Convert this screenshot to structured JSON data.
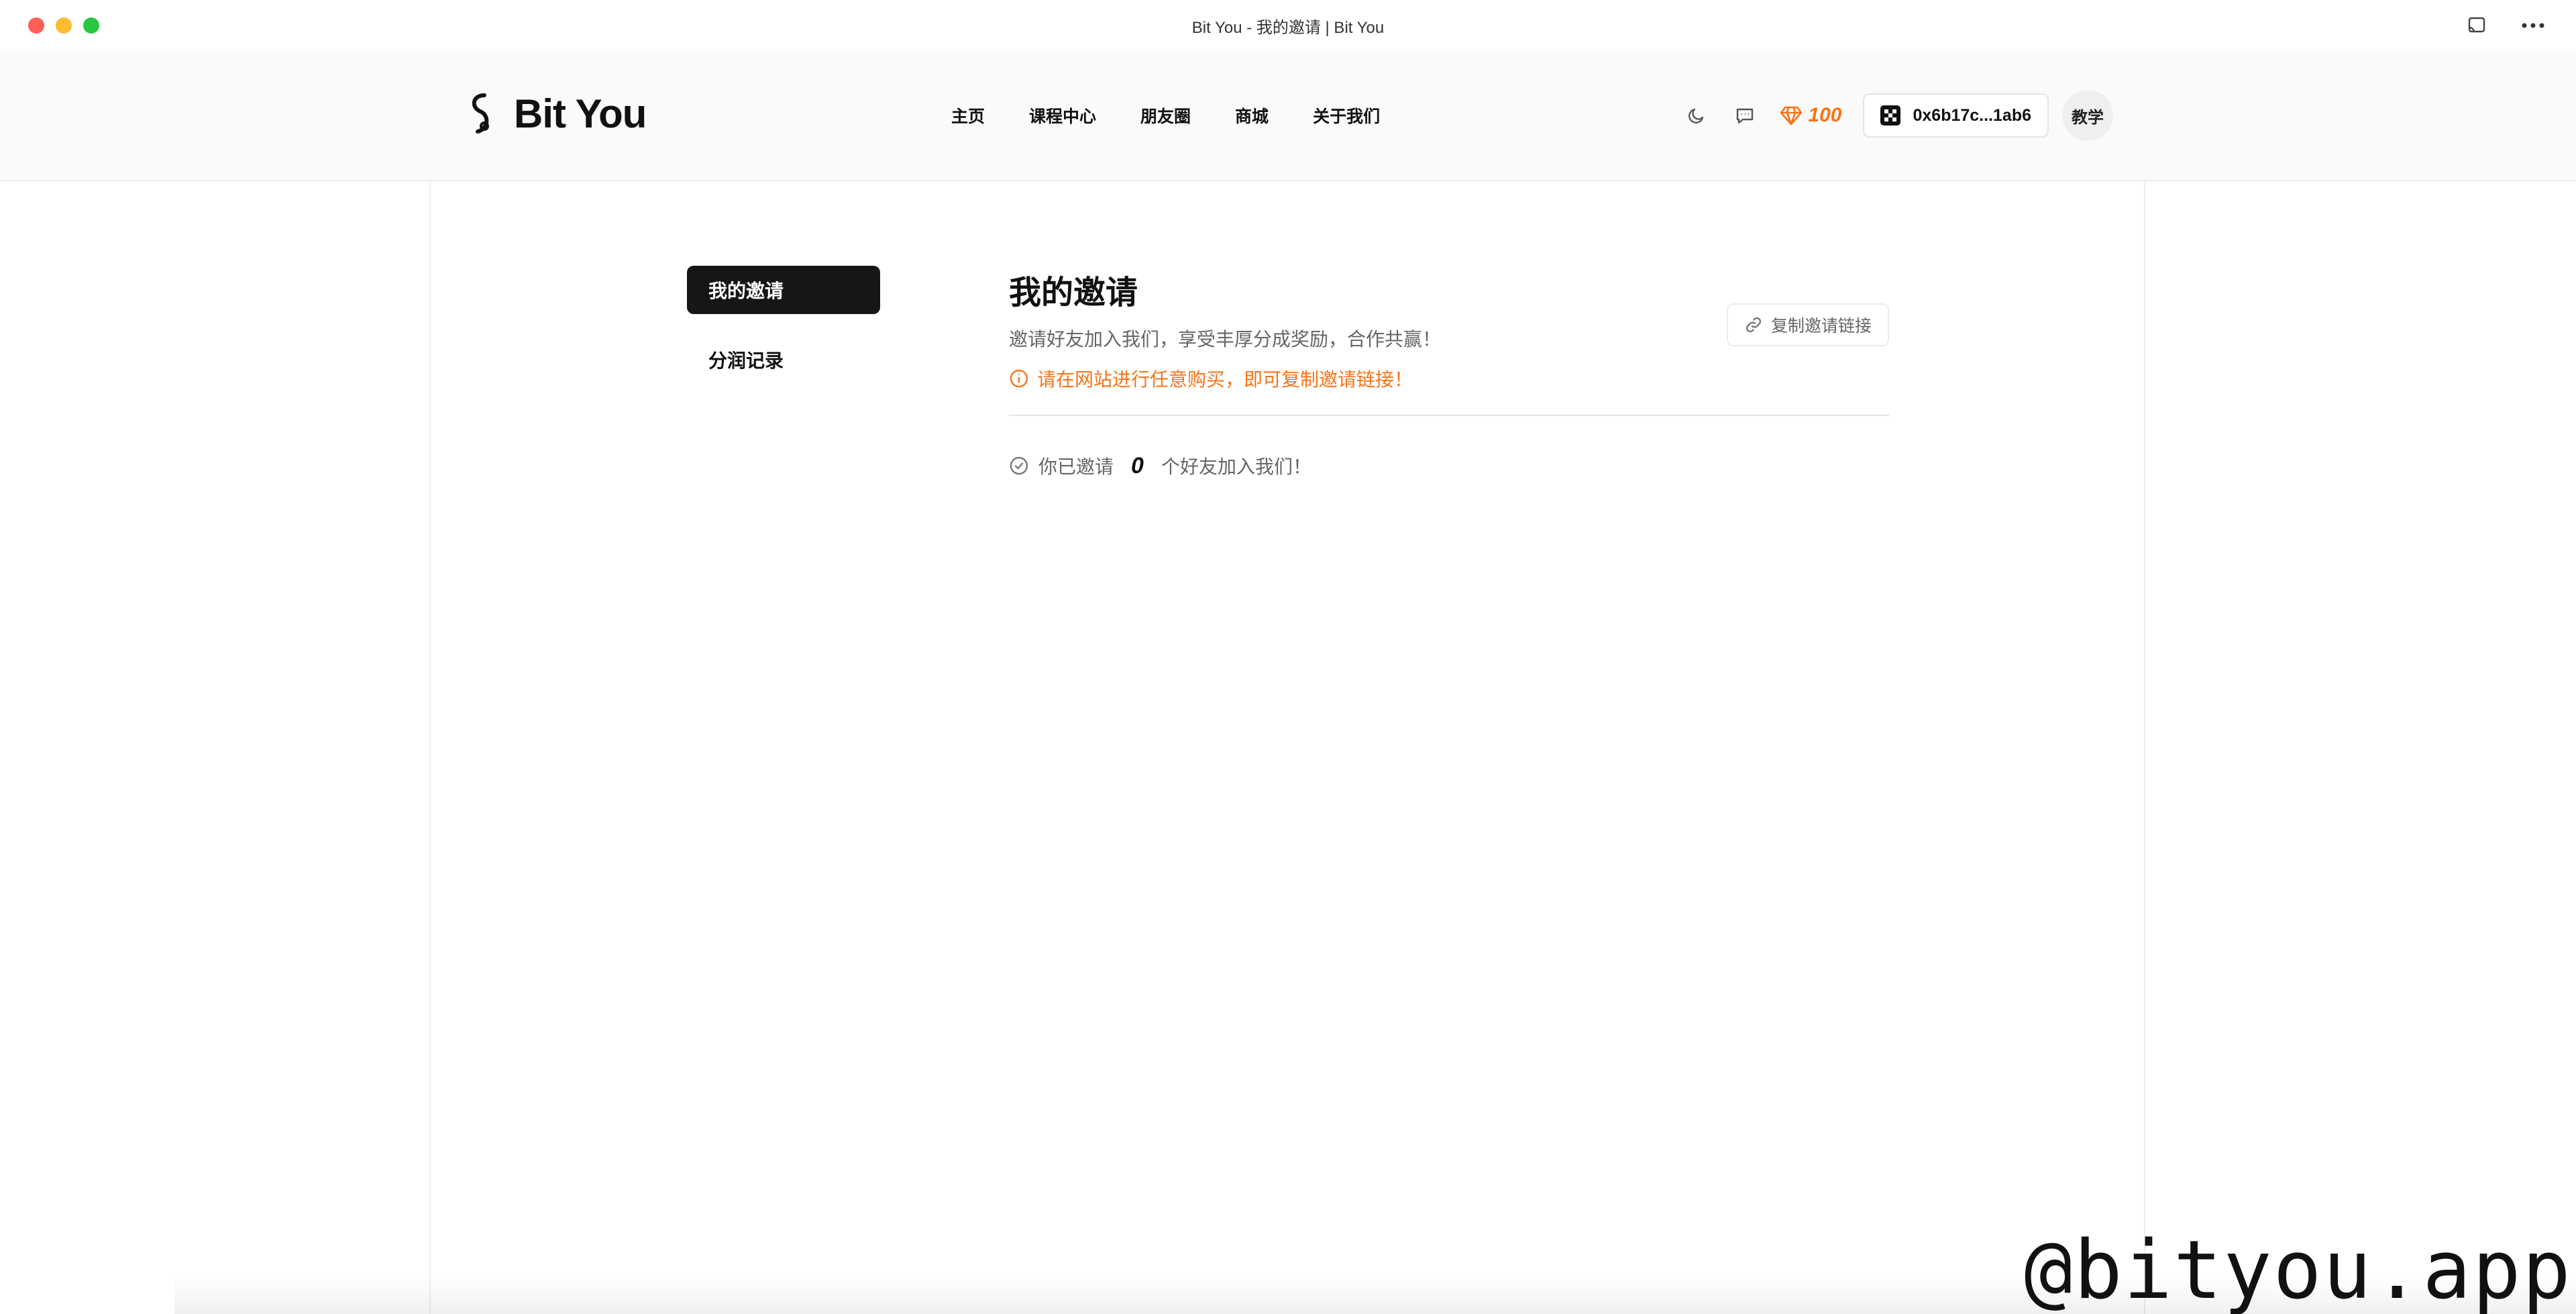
{
  "window": {
    "title": "Bit You - 我的邀请 | Bit You"
  },
  "header": {
    "brand": "Bit You",
    "nav": [
      "主页",
      "课程中心",
      "朋友圈",
      "商城",
      "关于我们"
    ],
    "gems": "100",
    "wallet": "0x6b17c...1ab6",
    "avatar_label": "教学",
    "icons": [
      "moon-icon",
      "message-icon",
      "gem-icon",
      "wallet-logo-icon"
    ]
  },
  "sidebar": {
    "items": [
      {
        "label": "我的邀请",
        "active": true
      },
      {
        "label": "分润记录",
        "active": false
      }
    ]
  },
  "main": {
    "title": "我的邀请",
    "description": "邀请好友加入我们，享受丰厚分成奖励，合作共赢！",
    "warning": "请在网站进行任意购买，即可复制邀请链接！",
    "copy_button": "复制邀请链接",
    "stat_prefix": "你已邀请",
    "stat_count": "0",
    "stat_suffix": "个好友加入我们！"
  },
  "watermark": "@bityou.app",
  "colors": {
    "accent": "#f97316",
    "active_bg": "#161616"
  }
}
